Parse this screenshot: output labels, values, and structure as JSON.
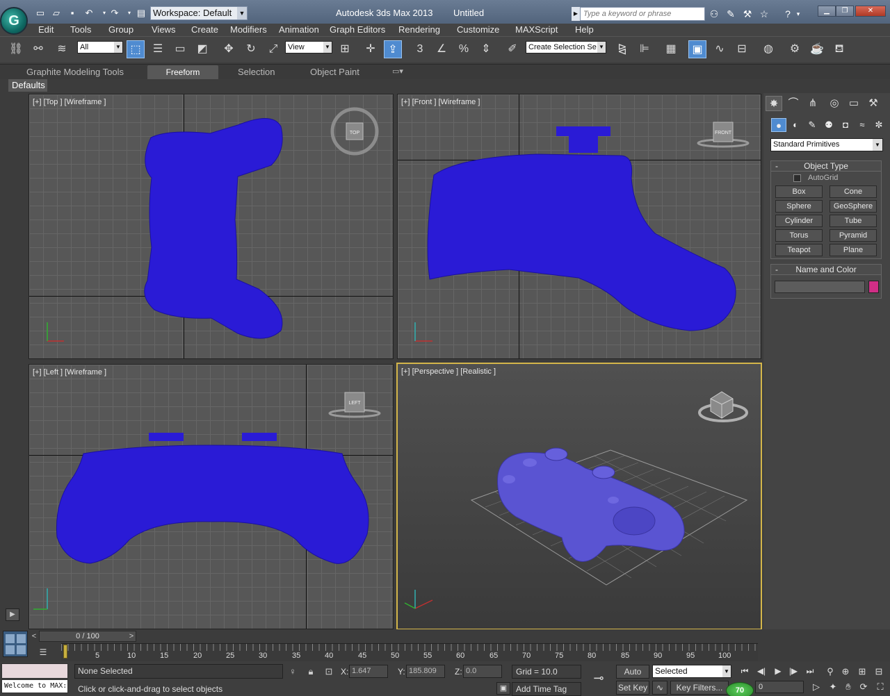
{
  "app": {
    "title": "Autodesk 3ds Max  2013",
    "document": "Untitled",
    "logo": "3ds-max-logo",
    "workspace": "Workspace: Default",
    "search_placeholder": "Type a keyword or phrase"
  },
  "menu": [
    "Edit",
    "Tools",
    "Group",
    "Views",
    "Create",
    "Modifiers",
    "Animation",
    "Graph Editors",
    "Rendering",
    "Customize",
    "MAXScript",
    "Help"
  ],
  "toolbar": {
    "selection_filter": "All",
    "reference_coord": "View",
    "named_selection_placeholder": "Create Selection Se",
    "snap_label": "3"
  },
  "ribbon": {
    "tabs": [
      "Graphite Modeling Tools",
      "Freeform",
      "Selection",
      "Object Paint"
    ],
    "active_tab": "Freeform",
    "panel": "Defaults"
  },
  "viewports": [
    {
      "id": "top",
      "label": "[+] [Top ] [Wireframe ]",
      "cube": "TOP"
    },
    {
      "id": "front",
      "label": "[+] [Front ] [Wireframe ]",
      "cube": "FRONT"
    },
    {
      "id": "left",
      "label": "[+] [Left ] [Wireframe ]",
      "cube": "LEFT"
    },
    {
      "id": "persp",
      "label": "[+] [Perspective ] [Realistic ]",
      "cube": ""
    }
  ],
  "command_panel": {
    "dropdown": "Standard Primitives",
    "object_type_title": "Object Type",
    "autogrid": "AutoGrid",
    "buttons": [
      "Box",
      "Cone",
      "Sphere",
      "GeoSphere",
      "Cylinder",
      "Tube",
      "Torus",
      "Pyramid",
      "Teapot",
      "Plane"
    ],
    "name_color_title": "Name and Color",
    "swatch_color": "#d02e86"
  },
  "timeline": {
    "slider": "0 / 100",
    "ticks": [
      "5",
      "10",
      "15",
      "20",
      "25",
      "30",
      "35",
      "40",
      "45",
      "50",
      "55",
      "60",
      "65",
      "70",
      "75",
      "80",
      "85",
      "90",
      "95",
      "100"
    ]
  },
  "status": {
    "maxscript": "Welcome to MAX:",
    "selection": "None Selected",
    "prompt": "Click or click-and-drag to select objects",
    "x_label": "X:",
    "x": "1.647",
    "y_label": "Y:",
    "y": "185.809",
    "z_label": "Z:",
    "z": "0.0",
    "grid": "Grid = 10.0",
    "add_time_tag": "Add Time Tag",
    "auto_key": "Auto Key",
    "set_key": "Set Key",
    "key_mode": "Selected",
    "key_filters": "Key Filters...",
    "frame": "0",
    "fps_badge": "70"
  },
  "colors": {
    "mesh": "#2a1bd6",
    "mesh_shaded": "#5a54d2",
    "accent": "#4f8bd0",
    "active_border": "#d4b64a"
  }
}
